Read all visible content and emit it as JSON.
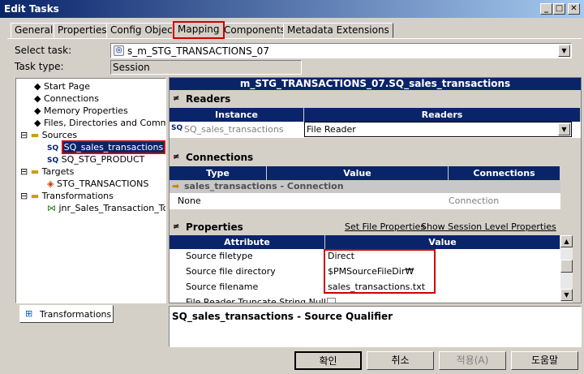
{
  "window": {
    "title": "Edit Tasks",
    "min": "_",
    "max": "□",
    "close": "✕"
  },
  "tabs": [
    "General",
    "Properties",
    "Config Object",
    "Mapping",
    "Components",
    "Metadata Extensions"
  ],
  "select_task": {
    "label": "Select task:",
    "value": "s_m_STG_TRANSACTIONS_07"
  },
  "task_type": {
    "label": "Task type:",
    "value": "Session"
  },
  "tree": {
    "items": [
      {
        "label": "Start Page"
      },
      {
        "label": "Connections"
      },
      {
        "label": "Memory Properties"
      },
      {
        "label": "Files, Directories and Command"
      },
      {
        "label": "Sources"
      },
      {
        "label": "SQ_sales_transactions"
      },
      {
        "label": "SQ_STG_PRODUCT"
      },
      {
        "label": "Targets"
      },
      {
        "label": "STG_TRANSACTIONS"
      },
      {
        "label": "Transformations"
      },
      {
        "label": "jnr_Sales_Transaction_To_"
      }
    ],
    "sq_prefix": "SQ",
    "bottom_tab": "Transformations"
  },
  "right": {
    "header": "m_STG_TRANSACTIONS_07.SQ_sales_transactions",
    "readers": {
      "title": "Readers",
      "col_instance": "Instance",
      "col_readers": "Readers",
      "instance": "SQ_sales_transactions",
      "reader": "File Reader",
      "sq": "SQ"
    },
    "connections": {
      "title": "Connections",
      "col_type": "Type",
      "col_value": "Value",
      "col_connections": "Connections",
      "group": "sales_transactions - Connection",
      "type": "None",
      "conn": "Connection"
    },
    "properties": {
      "title": "Properties",
      "link1": "Set File Properties",
      "link2": "Show Session Level Properties",
      "col_attr": "Attribute",
      "col_value": "Value",
      "rows": [
        {
          "attr": "Source filetype",
          "value": "Direct"
        },
        {
          "attr": "Source file directory",
          "value": "$PMSourceFileDir₩"
        },
        {
          "attr": "Source filename",
          "value": "sales_transactions.txt"
        },
        {
          "attr": "File Reader Truncate String Null",
          "value": ""
        }
      ]
    },
    "description": "SQ_sales_transactions - Source Qualifier",
    "collapse": "≠"
  },
  "buttons": {
    "ok": "확인",
    "cancel": "취소",
    "apply": "적용(A)",
    "help": "도움말"
  },
  "colors": {
    "navy": "#0a246a",
    "highlight_red": "#d00000",
    "face": "#d4d0c8"
  }
}
